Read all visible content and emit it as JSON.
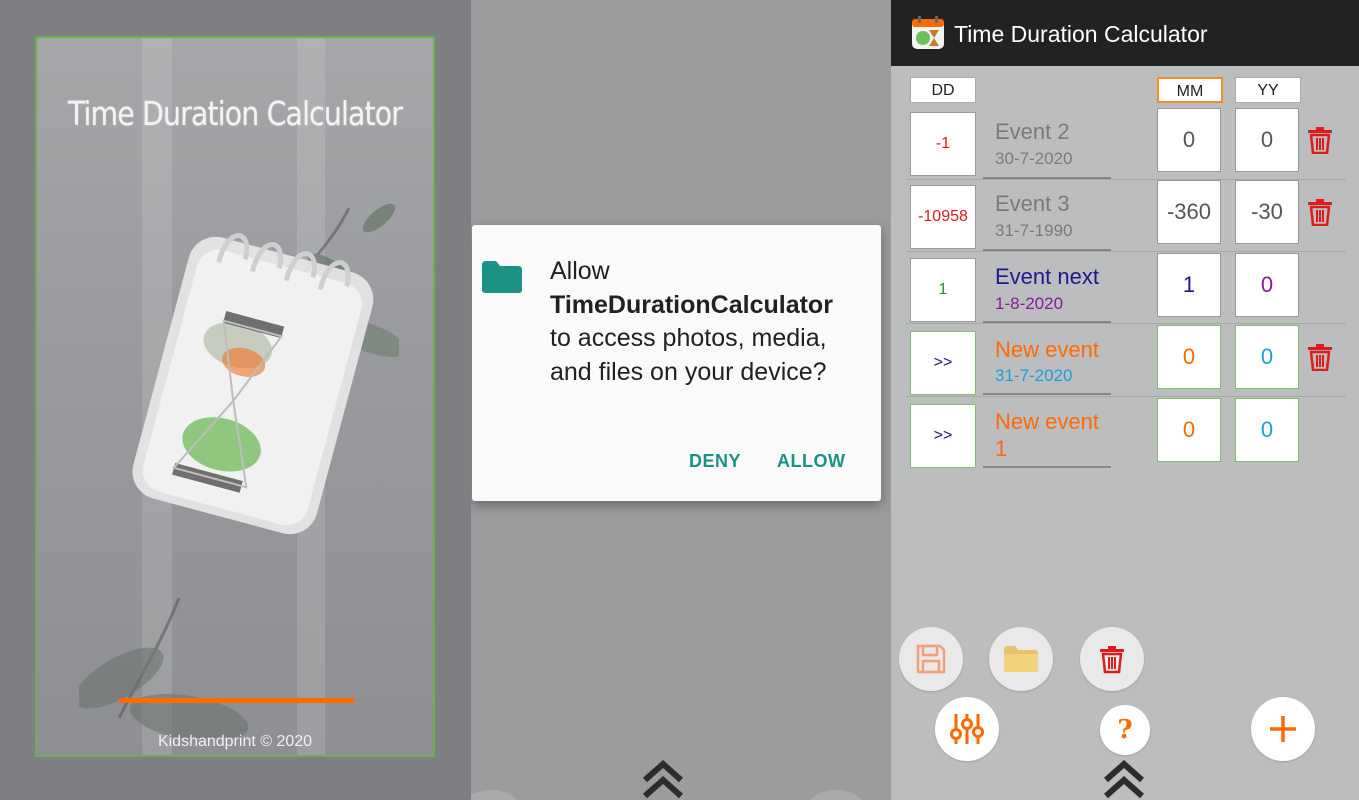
{
  "splash": {
    "title": "Time Duration Calculator",
    "copyright": "Kidshandprint © 2020",
    "progress_fraction": 0.47
  },
  "dialog": {
    "line1": "Allow",
    "app_name": "TimeDurationCalculator",
    "line2": "to access photos, media, and files on your device?",
    "deny_label": "DENY",
    "allow_label": "ALLOW"
  },
  "app": {
    "title": "Time Duration Calculator",
    "headers": {
      "dd": "DD",
      "mm": "MM",
      "yy": "YY"
    },
    "rows": [
      {
        "dd": "-1",
        "name": "Event 2",
        "date": "30-7-2020",
        "mm": "0",
        "yy": "0",
        "deletable": true
      },
      {
        "dd": "-10958",
        "name": "Event 3",
        "date": "31-7-1990",
        "mm": "-360",
        "yy": "-30",
        "deletable": true
      },
      {
        "dd": "1",
        "name": "Event next",
        "date": "1-8-2020",
        "mm": "1",
        "yy": "0",
        "deletable": false
      },
      {
        "dd": ">>",
        "name": "New event",
        "date": "31-7-2020",
        "mm": "0",
        "yy": "0",
        "deletable": true
      },
      {
        "dd": ">>",
        "name": "New event 1",
        "date": "",
        "mm": "0",
        "yy": "0",
        "deletable": false
      }
    ],
    "toolbar": [
      "save-icon",
      "folder-icon",
      "trash-icon",
      "sliders-icon",
      "help-icon",
      "add-icon"
    ],
    "help_glyph": "?",
    "colors": {
      "accent": "#ff6a00",
      "negative": "#e01b1b",
      "neutral_event": "#7a7a7a",
      "next_event_name": "#1c1a8c",
      "next_event_date": "#8b1a9e",
      "next_event_dd": "#2e8b2e",
      "new_event_name": "#ff6a00",
      "new_event_date": "#1aa0d8",
      "chevron_text": "#1c1a6b",
      "teal": "#1a9384"
    }
  }
}
